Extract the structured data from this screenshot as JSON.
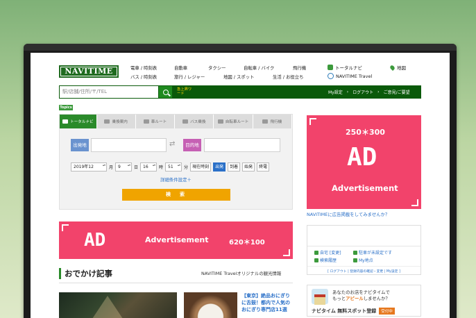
{
  "header": {
    "logo": "NAVITIME",
    "nav_row1": [
      "電車 / 時刻表",
      "自動車",
      "タクシー",
      "自転車 / バイク",
      "飛行機"
    ],
    "nav_row2": [
      "バス / 時刻表",
      "旅行 / レジャー",
      "地図 / スポット",
      "生活 / お役立ち"
    ],
    "right_row1": [
      "トータルナビ",
      "地図"
    ],
    "right_row2": "NAVITIME Travel"
  },
  "searchbar": {
    "placeholder": "駅/店舗/住所/〒/TEL",
    "keyword": "急上昇ワード",
    "links": [
      "My設定",
      "ログアウト",
      "ご意見/ご要望"
    ]
  },
  "topics": "Topics",
  "route": {
    "tabs": [
      "トータルナビ",
      "乗換案内",
      "車ルート",
      "バス乗換",
      "自転車ルート",
      "飛行機"
    ],
    "departure_label": "出発地",
    "destination_label": "目的地",
    "year_month": "2019年12",
    "month_unit": "月",
    "day": "9",
    "day_unit": "日",
    "hour": "16",
    "hour_unit": "時",
    "minute": "51",
    "minute_unit": "分",
    "now_button": "現在時刻",
    "modes": [
      "出発",
      "到着",
      "始発",
      "終電"
    ],
    "detail_link": "詳細条件設定＋",
    "search_button": "検　索"
  },
  "ad_big": {
    "size": "250＊300",
    "title": "AD",
    "subtitle": "Advertisement"
  },
  "ad_wide": {
    "title": "AD",
    "subtitle": "Advertisement",
    "size": "620＊100"
  },
  "ad_link": "NAVITIMEに広告掲載をしてみませんか？",
  "my_settings": {
    "items": [
      "自宅 [変更]",
      "駐車が未設定です",
      "検索履歴",
      "My地点"
    ],
    "footer": "[ ログアウト | 登録内容の確認・変更 | My設定 ]"
  },
  "spot_promo": {
    "line1": "あなたのお店をナビタイムで",
    "line2_prefix": "もっと",
    "line2_highlight": "アピール",
    "line2_suffix": "しませんか？",
    "cta": "ナビタイム 無料スポット登録",
    "badge": "受付中"
  },
  "articles": {
    "section_title": "おでかけ記事",
    "section_sub": "NAVITIME Travelオリジナルの観光情報",
    "item_title": "【東京】絶品おにぎりに舌鼓！都内で人気のおにぎり専門店11選"
  }
}
